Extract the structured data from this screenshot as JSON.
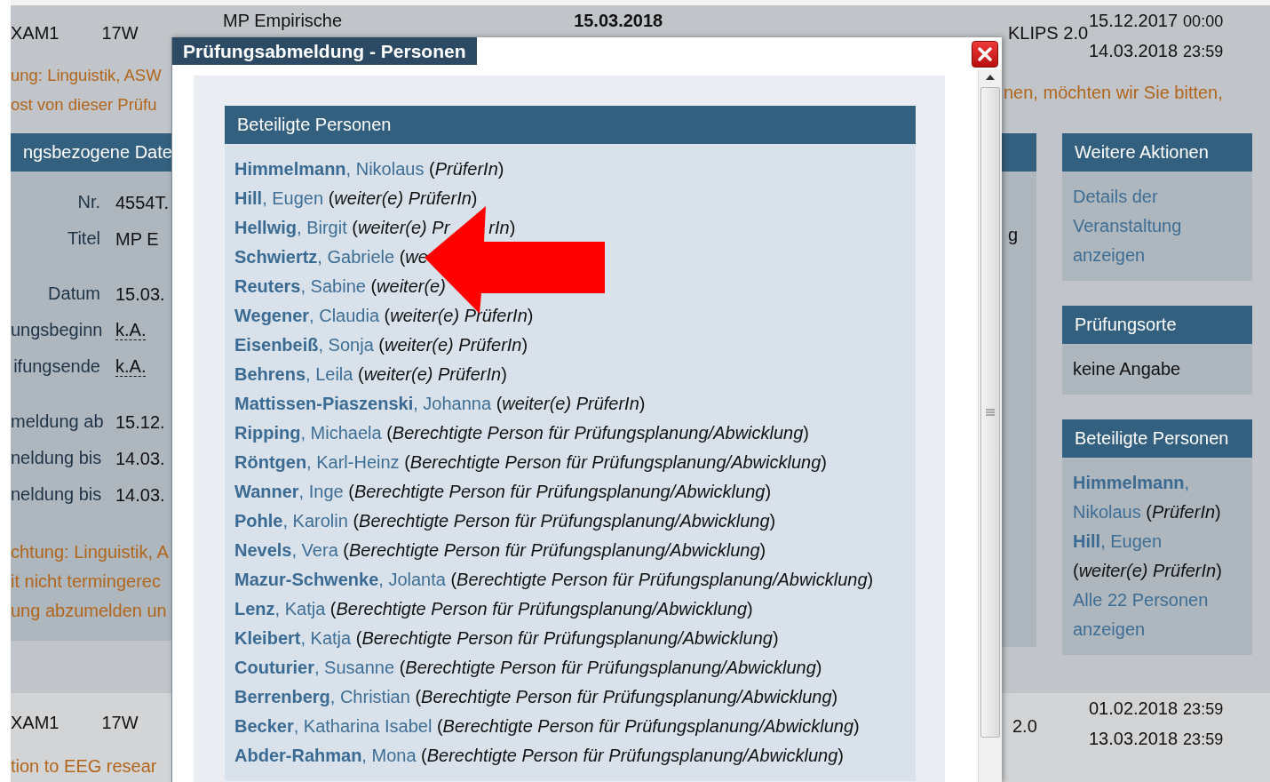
{
  "top_row": {
    "left": [
      "XAM1",
      "17W"
    ],
    "title": "MP Empirische",
    "date": "15.03.2018",
    "system": "KLIPS 2.0",
    "dates": [
      {
        "date": "15.12.2017",
        "time": "00:00"
      },
      {
        "date": "14.03.2018",
        "time": "23:59"
      }
    ]
  },
  "notices_top": [
    "ung: Linguistik, ASW",
    "ost von dieser Prüfu"
  ],
  "notice_right": "nen, möchten wir Sie bitten,",
  "details_panel": {
    "title": "ngsbezogene Date",
    "rows": [
      {
        "label": "Nr.",
        "value": "4554T.",
        "kind": "text"
      },
      {
        "label": "Titel",
        "value": "MP E",
        "kind": "text"
      },
      {
        "label": "Datum",
        "value": "15.03.",
        "kind": "text",
        "gap": true
      },
      {
        "label": "ungsbeginn",
        "value": "k.A.",
        "kind": "abbr"
      },
      {
        "label": "ifungsende",
        "value": "k.A.",
        "kind": "abbr"
      },
      {
        "label": "meldung ab",
        "value": "15.12.",
        "kind": "text",
        "gap": true
      },
      {
        "label": "neldung bis",
        "value": "14.03.",
        "kind": "text"
      },
      {
        "label": "neldung bis",
        "value": "14.03.",
        "kind": "text"
      }
    ],
    "notices": [
      "chtung: Linguistik, A",
      "it nicht termingerec",
      "ung abzumelden un"
    ]
  },
  "middle_panel": {
    "text": "g"
  },
  "sidebar": [
    {
      "title": "Weitere Aktionen",
      "kind": "links",
      "links": [
        "Details der Veranstaltung anzeigen"
      ]
    },
    {
      "title": "Prüfungsorte",
      "kind": "text",
      "text": "keine Angabe"
    },
    {
      "title": "Beteiligte Personen",
      "kind": "persons",
      "persons": [
        {
          "name": "**Himmelmann**, Nikolaus",
          "role": "(*PrüferIn*)"
        },
        {
          "name": "**Hill**, Eugen",
          "role": "(*weiter(e) PrüferIn*)"
        }
      ],
      "more": "Alle 22 Personen anzeigen"
    }
  ],
  "bottom_row": {
    "left": [
      "XAM1",
      "17W"
    ],
    "note": "tion to EEG resear",
    "system": "2.0",
    "dates": [
      {
        "date": "01.02.2018",
        "time": "23:59"
      },
      {
        "date": "13.03.2018",
        "time": "23:59"
      }
    ]
  },
  "dialog": {
    "title": "Prüfungsabmeldung - Personen",
    "box_title": "Beteiligte Personen",
    "persons": [
      {
        "name": "**Himmelmann**, Nikolaus",
        "role": "(*PrüferIn*)"
      },
      {
        "name": "**Hill**, Eugen",
        "role": "(*weiter(e) PrüferIn*)"
      },
      {
        "name": "**Hellwig**, Birgit",
        "role": "(*weiter(e) Pr*",
        "role_tail": "*rIn*)"
      },
      {
        "name": "**Schwiertz**, Gabriele",
        "role": "(*we*"
      },
      {
        "name": "**Reuters**, Sabine",
        "role": "(*weiter(e)*"
      },
      {
        "name": "**Wegener**, Claudia",
        "role": "(*weiter(e) PrüferIn*)"
      },
      {
        "name": "**Eisenbeiß**, Sonja",
        "role": "(*weiter(e) PrüferIn*)"
      },
      {
        "name": "**Behrens**, Leila",
        "role": "(*weiter(e) PrüferIn*)"
      },
      {
        "name": "**Mattissen-Piaszenski**, Johanna",
        "role": "(*weiter(e) PrüferIn*)"
      },
      {
        "name": "**Ripping**, Michaela",
        "role": "(*Berechtigte Person für Prüfungsplanung/Abwicklung*)"
      },
      {
        "name": "**Röntgen**, Karl-Heinz",
        "role": "(*Berechtigte Person für Prüfungsplanung/Abwicklung*)"
      },
      {
        "name": "**Wanner**, Inge",
        "role": "(*Berechtigte Person für Prüfungsplanung/Abwicklung*)"
      },
      {
        "name": "**Pohle**, Karolin",
        "role": "(*Berechtigte Person für Prüfungsplanung/Abwicklung*)"
      },
      {
        "name": "**Nevels**, Vera",
        "role": "(*Berechtigte Person für Prüfungsplanung/Abwicklung*)"
      },
      {
        "name": "**Mazur-Schwenke**, Jolanta",
        "role": "(*Berechtigte Person für Prüfungsplanung/Abwicklung*)"
      },
      {
        "name": "**Lenz**, Katja",
        "role": "(*Berechtigte Person für Prüfungsplanung/Abwicklung*)"
      },
      {
        "name": "**Kleibert**, Katja",
        "role": "(*Berechtigte Person für Prüfungsplanung/Abwicklung*)"
      },
      {
        "name": "**Couturier**, Susanne",
        "role": "(*Berechtigte Person für Prüfungsplanung/Abwicklung*)"
      },
      {
        "name": "**Berrenberg**, Christian",
        "role": "(*Berechtigte Person für Prüfungsplanung/Abwicklung*)"
      },
      {
        "name": "**Becker**, Katharina Isabel",
        "role": "(*Berechtigte Person für Prüfungsplanung/Abwicklung*)"
      },
      {
        "name": "**Abder-Rahman**, Mona",
        "role": "(*Berechtigte Person für Prüfungsplanung/Abwicklung*)"
      }
    ]
  }
}
